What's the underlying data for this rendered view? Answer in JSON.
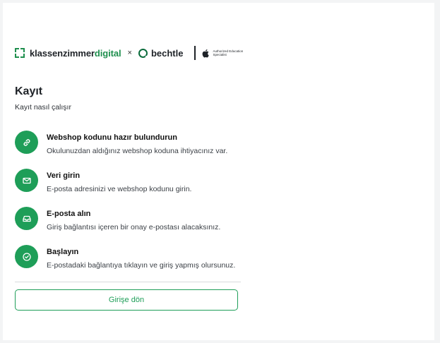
{
  "brand": {
    "kz_prefix": "klassenzimmer",
    "kz_suffix": "digital",
    "separator": "×",
    "partner": "bechtle",
    "apple_text": "Authorized Education Specialist",
    "accent_color": "#1e9e58"
  },
  "page": {
    "title": "Kayıt",
    "subtitle": "Kayıt nasıl çalışır"
  },
  "steps": [
    {
      "icon": "link-icon",
      "title": "Webshop kodunu hazır bulundurun",
      "description": "Okulunuzdan aldığınız webshop koduna ihtiyacınız var."
    },
    {
      "icon": "envelope-icon",
      "title": "Veri girin",
      "description": "E-posta adresinizi ve webshop kodunu girin."
    },
    {
      "icon": "inbox-icon",
      "title": "E-posta alın",
      "description": "Giriş bağlantısı içeren bir onay e-postası alacaksınız."
    },
    {
      "icon": "check-circle-icon",
      "title": "Başlayın",
      "description": "E-postadaki bağlantıya tıklayın ve giriş yapmış olursunuz."
    }
  ],
  "back_button": {
    "label": "Girişe dön"
  }
}
